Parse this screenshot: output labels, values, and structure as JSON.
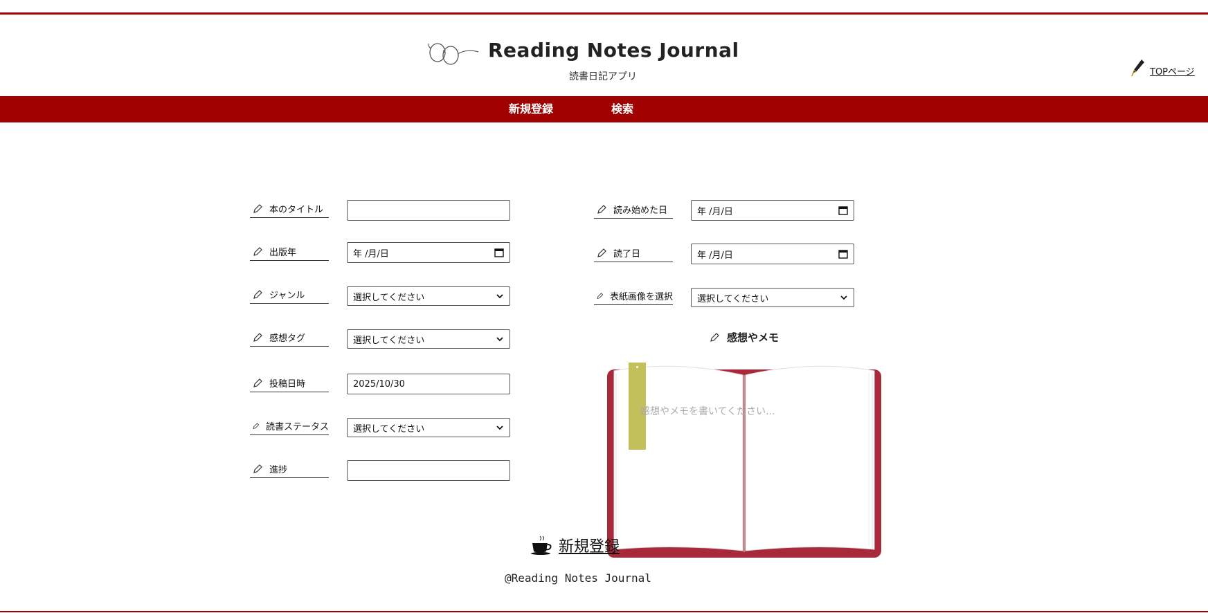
{
  "header": {
    "title": "Reading Notes Journal",
    "subtitle": "読書日記アプリ",
    "top_link": "TOPページ",
    "logo_icon": "glasses-icon",
    "top_link_icon": "fountain-pen-icon"
  },
  "nav": {
    "items": [
      {
        "label": "新規登録"
      },
      {
        "label": "検索"
      }
    ]
  },
  "form_left": [
    {
      "label": "本のタイトル",
      "type": "text",
      "value": ""
    },
    {
      "label": "出版年",
      "type": "date",
      "value": "年 /月/日"
    },
    {
      "label": "ジャンル",
      "type": "select",
      "value": "選択してください"
    },
    {
      "label": "感想タグ",
      "type": "select",
      "value": "選択してください"
    },
    {
      "label": "投稿日時",
      "type": "text",
      "value": "2025/10/30"
    },
    {
      "label": "読書ステータス",
      "type": "select",
      "value": "選択してください"
    },
    {
      "label": "進捗",
      "type": "text",
      "value": ""
    }
  ],
  "form_right": [
    {
      "label": "読み始めた日",
      "type": "date",
      "value": "年 /月/日"
    },
    {
      "label": "読了日",
      "type": "date",
      "value": "年 /月/日"
    },
    {
      "label": "表紙画像を選択",
      "type": "select",
      "value": "選択してください"
    }
  ],
  "memo": {
    "heading": "感想やメモ",
    "placeholder": "感想やメモを書いてください..."
  },
  "submit": {
    "label": "新規登録",
    "icon": "coffee-cup-icon"
  },
  "footer": {
    "text": "@Reading Notes Journal"
  },
  "colors": {
    "accent": "#a00000",
    "book_cover": "#a8293a",
    "bookmark": "#c2c05a"
  }
}
